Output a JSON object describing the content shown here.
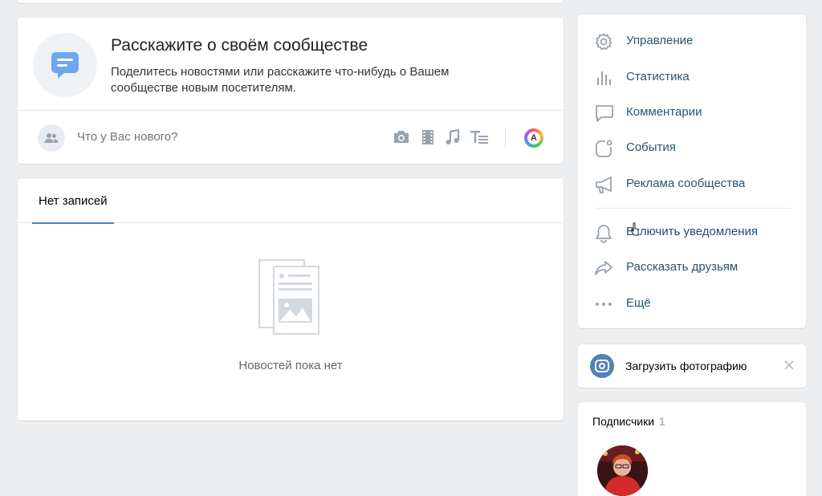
{
  "intro": {
    "title": "Расскажите о своём сообществе",
    "description": "Поделитесь новостями или расскажите что-нибудь о Вашем сообществе новым посетителям."
  },
  "composer": {
    "placeholder": "Что у Вас нового?",
    "attachments": [
      "camera-icon",
      "video-icon",
      "music-icon",
      "article-icon"
    ],
    "author_badge": "A"
  },
  "posts": {
    "tab_label": "Нет записей",
    "empty_text": "Новостей пока нет"
  },
  "menu": {
    "items": [
      {
        "label": "Управление",
        "icon": "gear-icon"
      },
      {
        "label": "Статистика",
        "icon": "statistics-icon"
      },
      {
        "label": "Комментарии",
        "icon": "comment-icon"
      },
      {
        "label": "События",
        "icon": "events-icon"
      },
      {
        "label": "Реклама сообщества",
        "icon": "megaphone-icon"
      }
    ],
    "secondary": [
      {
        "label": "Включить уведомления",
        "icon": "bell-icon"
      },
      {
        "label": "Рассказать друзьям",
        "icon": "share-icon"
      },
      {
        "label": "Ещё",
        "icon": "more-icon"
      }
    ]
  },
  "upload": {
    "label": "Загрузить фотографию"
  },
  "subscribers": {
    "title": "Подписчики",
    "count": "1"
  },
  "colors": {
    "accent": "#5181b8",
    "link": "#285473",
    "icon": "#99a2ad",
    "background": "#edeef0"
  }
}
